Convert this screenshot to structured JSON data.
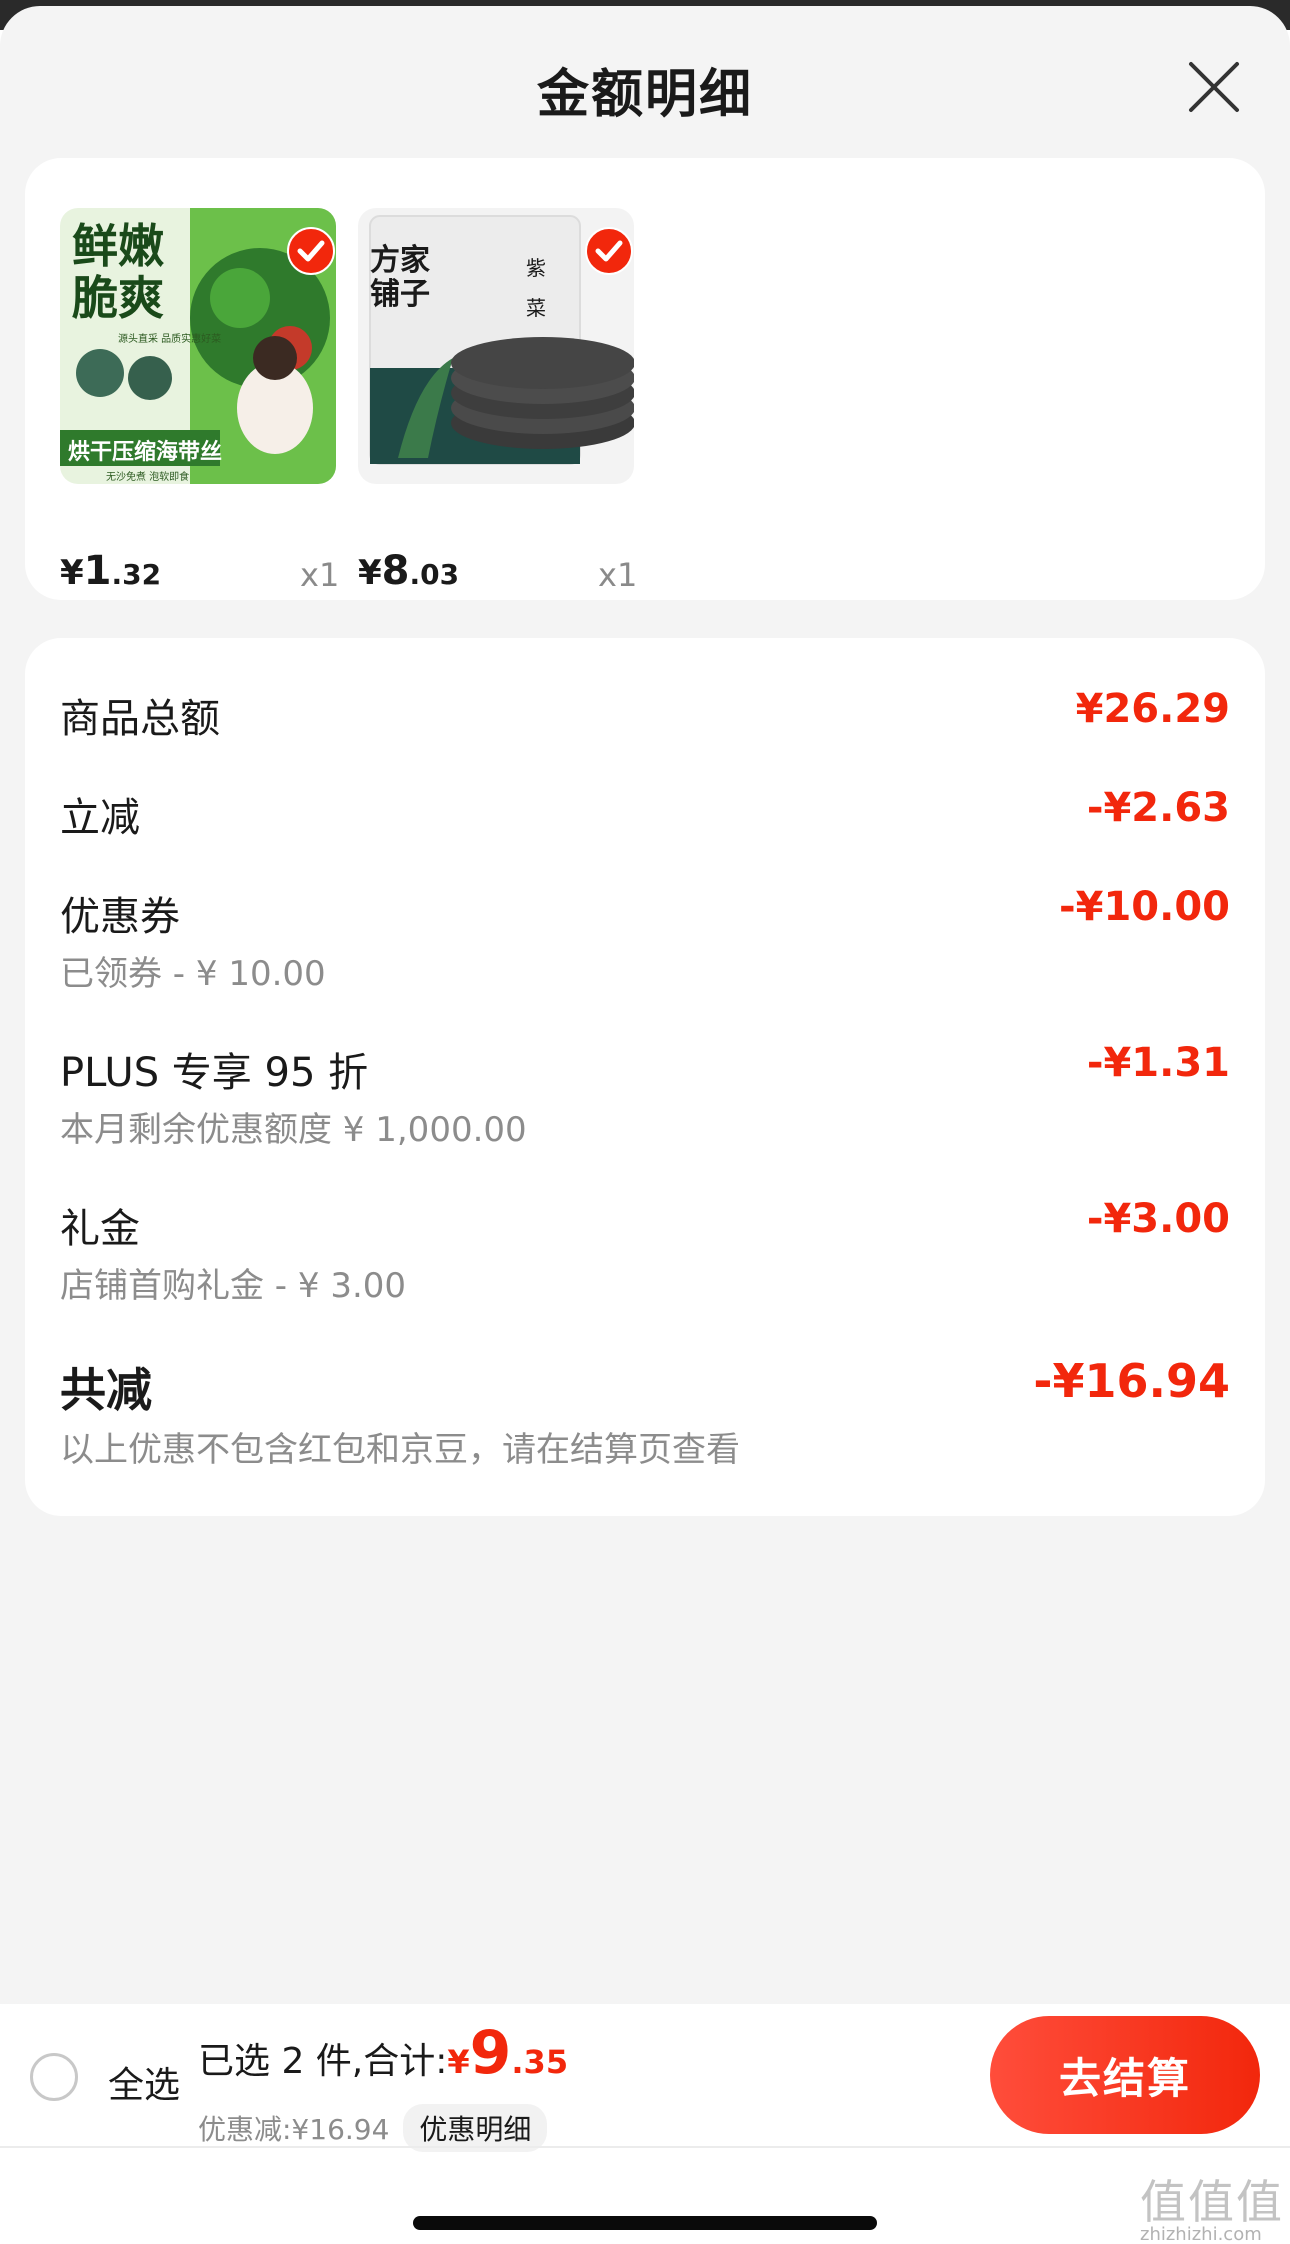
{
  "sheet": {
    "title": "金额明细"
  },
  "products": [
    {
      "price_currency": "¥",
      "price_int": "1",
      "price_dec": ".32",
      "quantity": "x1",
      "image_lines": [
        "鲜嫩",
        "脆爽"
      ],
      "image_tag": "烘干压缩海带丝",
      "image_sub": "源头直采 品质实惠好菜",
      "image_foot": "无沙免煮 泡软即食"
    },
    {
      "price_currency": "¥",
      "price_int": "8",
      "price_dec": ".03",
      "quantity": "x1",
      "image_brand": "方家铺子",
      "image_label": "紫菜"
    }
  ],
  "summary": {
    "items_total_label": "商品总额",
    "items_total_amount": "¥26.29",
    "instant_label": "立减",
    "instant_amount": "-¥2.63",
    "coupon_label": "优惠券",
    "coupon_amount": "-¥10.00",
    "coupon_sub": "已领券 - ¥ 10.00",
    "plus_label": "PLUS 专享 95 折",
    "plus_amount": "-¥1.31",
    "plus_sub": "本月剩余优惠额度 ¥ 1,000.00",
    "gift_label": "礼金",
    "gift_amount": "-¥3.00",
    "gift_sub": "店铺首购礼金 - ¥ 3.00",
    "total_label": "共减",
    "total_amount": "-¥16.94",
    "total_sub": "以上优惠不包含红包和京豆，请在结算页查看"
  },
  "bottom": {
    "select_all": "全选",
    "selected_text": "已选 2 件,合计:",
    "sum_currency": "¥",
    "sum_int": "9",
    "sum_dec": ".35",
    "discount_text": "优惠减:¥16.94",
    "detail_label": "优惠明细",
    "checkout_label": "去结算"
  },
  "watermark": {
    "glyphs": "值值值",
    "url": "zhizhizhi.com"
  },
  "colors": {
    "accent": "#f2270c",
    "background": "#f4f4f4",
    "card": "#ffffff"
  }
}
